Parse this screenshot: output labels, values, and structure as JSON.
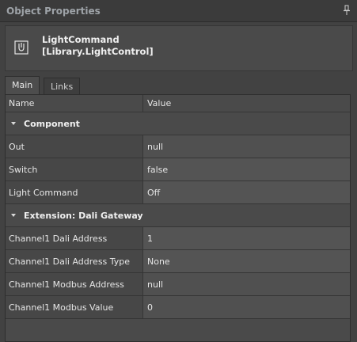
{
  "panel": {
    "title": "Object Properties"
  },
  "object": {
    "name": "LightCommand",
    "type": "[Library.LightControl]",
    "icon": "light-command-icon"
  },
  "tabs": [
    {
      "label": "Main",
      "active": true
    },
    {
      "label": "Links",
      "active": false
    }
  ],
  "grid": {
    "columns": [
      "Name",
      "Value"
    ],
    "categories": [
      {
        "label": "Component",
        "expanded": true,
        "rows": [
          {
            "name": "Out",
            "value": "null"
          },
          {
            "name": "Switch",
            "value": "false"
          },
          {
            "name": "Light Command",
            "value": "Off"
          }
        ]
      },
      {
        "label": "Extension: Dali Gateway",
        "expanded": true,
        "rows": [
          {
            "name": "Channel1 Dali Address",
            "value": "1"
          },
          {
            "name": "Channel1 Dali Address Type",
            "value": "None"
          },
          {
            "name": "Channel1 Modbus Address",
            "value": "null"
          },
          {
            "name": "Channel1 Modbus Value",
            "value": "0"
          }
        ]
      }
    ]
  },
  "colors": {
    "background": "#424242",
    "title_text": "#9ea3a8"
  }
}
